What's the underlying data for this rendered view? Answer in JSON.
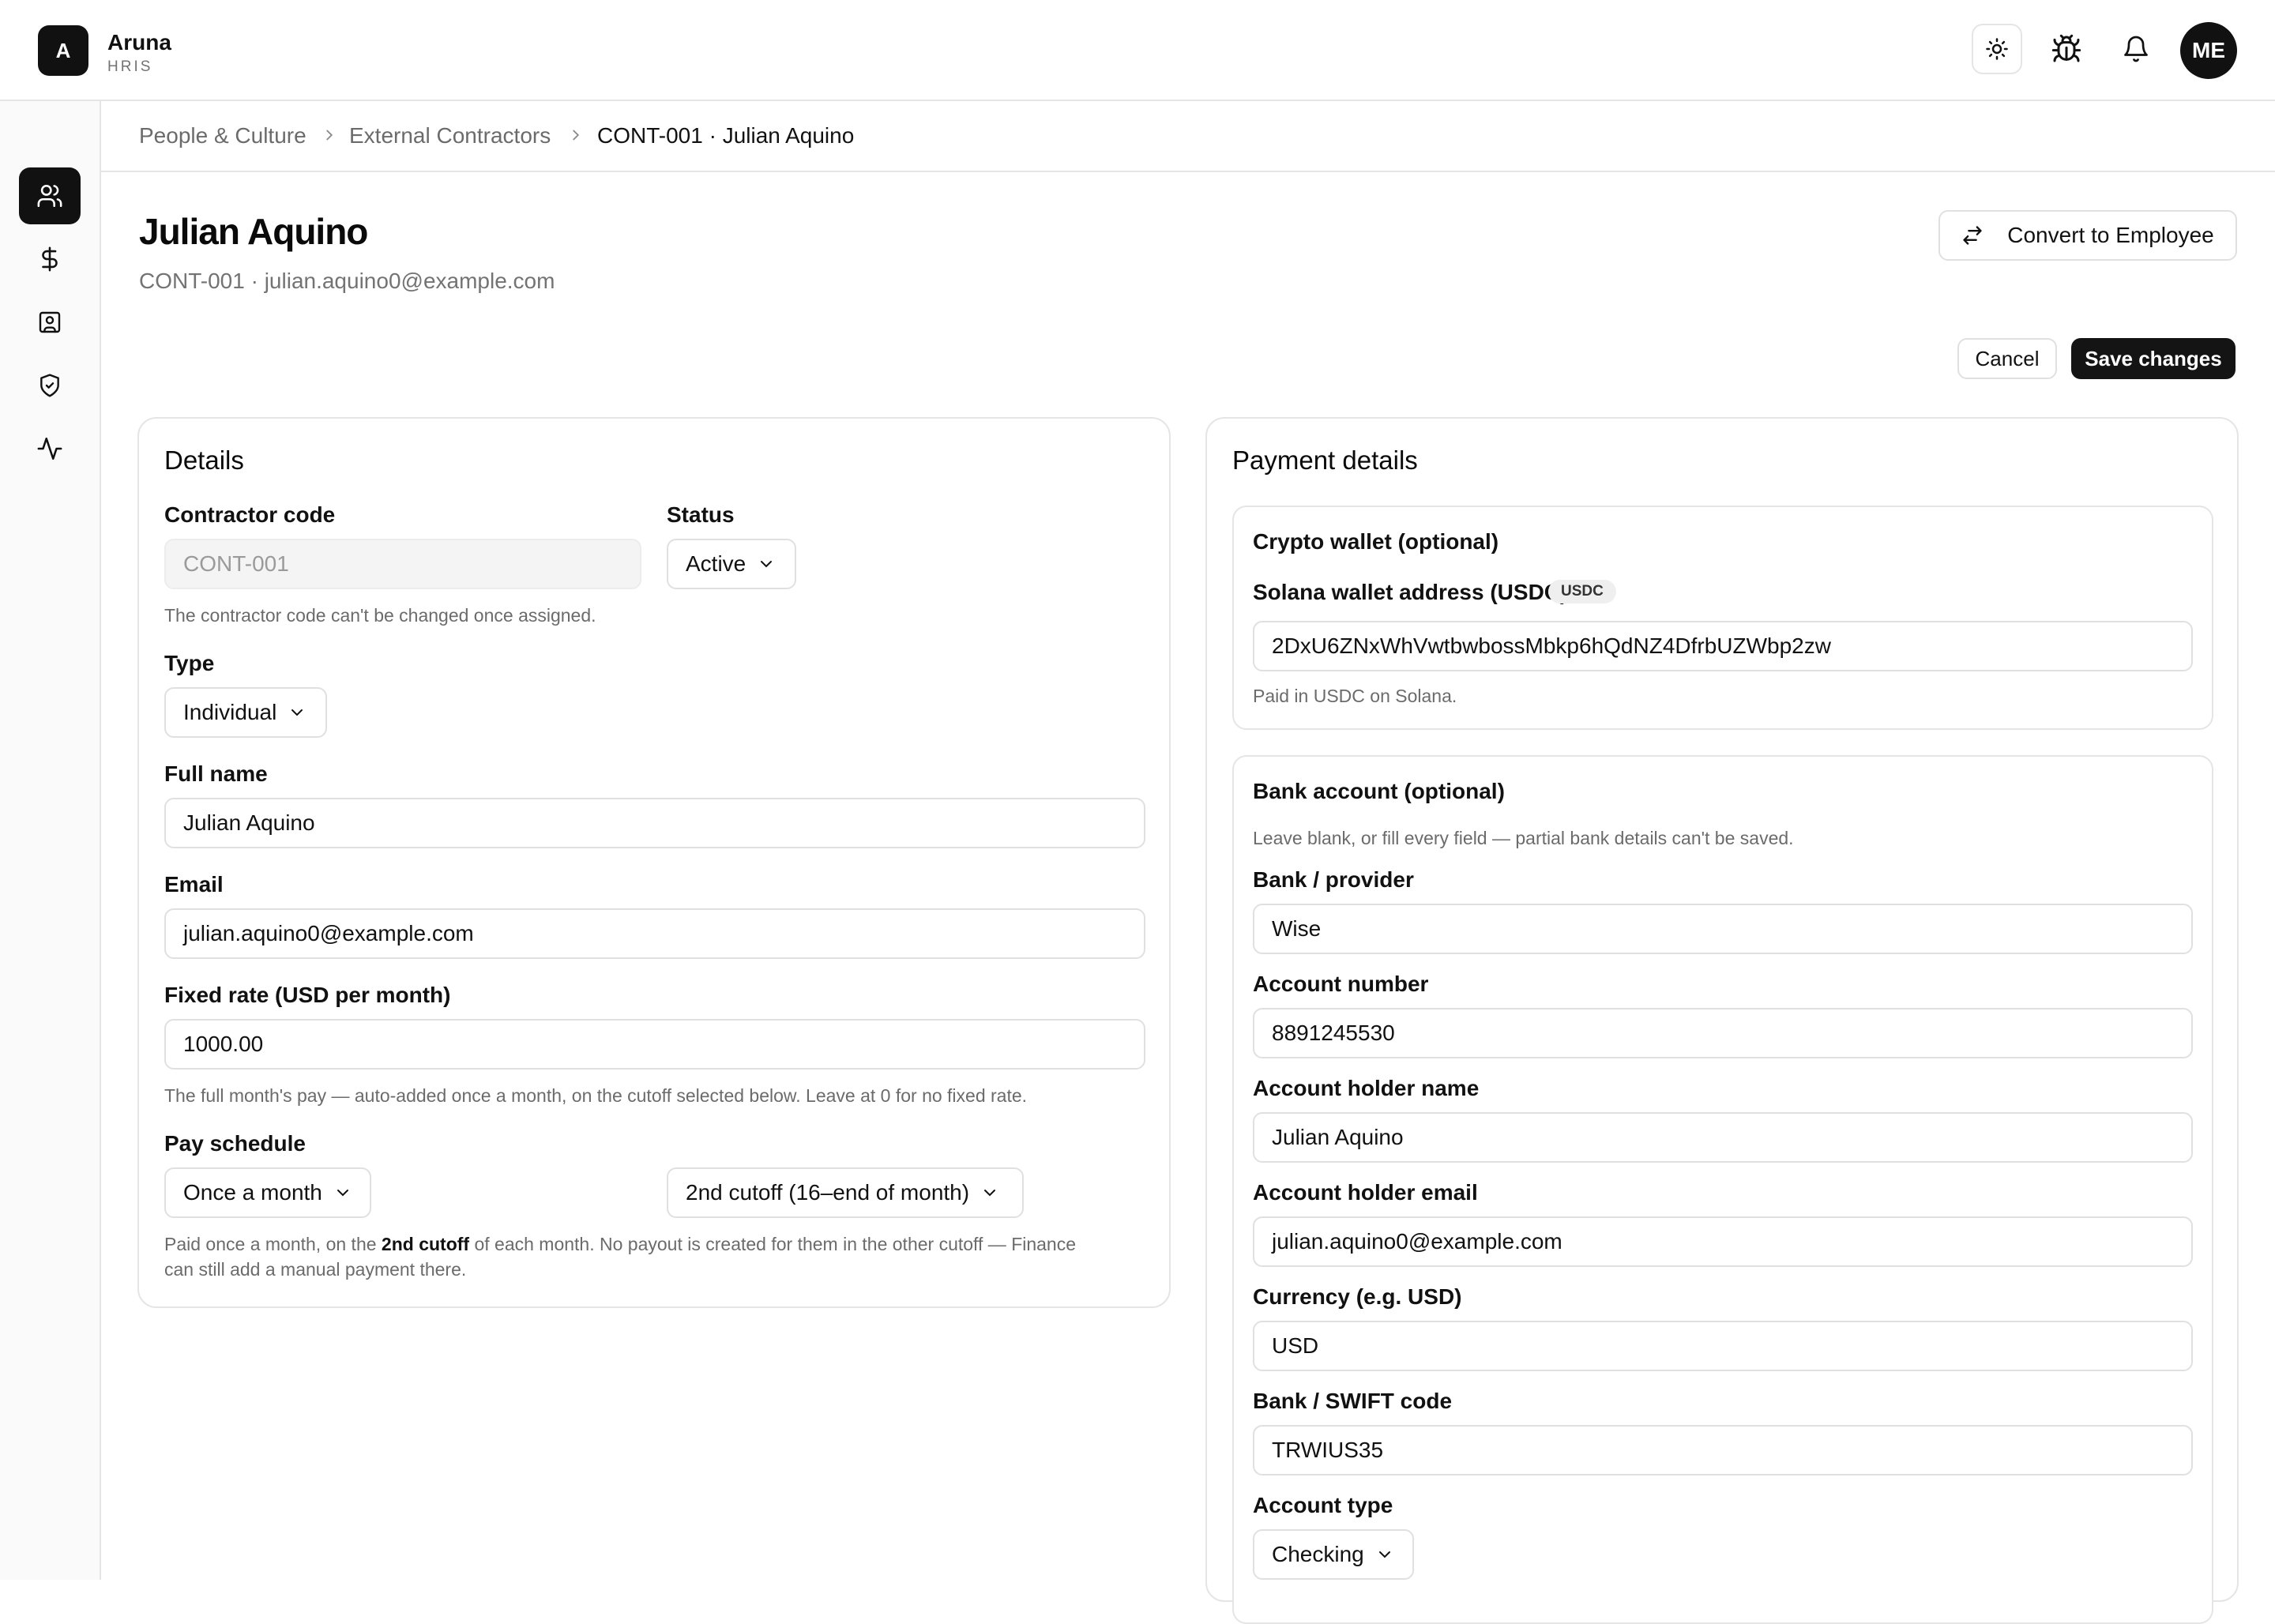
{
  "app": {
    "logo_letter": "A",
    "name": "Aruna",
    "subtitle": "HRIS"
  },
  "topbar": {
    "theme_icon": "sun-icon",
    "bug_icon": "bug-icon",
    "bell_icon": "bell-icon",
    "avatar_initials": "ME"
  },
  "sidebar": {
    "items": [
      {
        "icon": "users-icon",
        "active": true
      },
      {
        "icon": "dollar-icon",
        "active": false
      },
      {
        "icon": "contact-card-icon",
        "active": false
      },
      {
        "icon": "shield-check-icon",
        "active": false
      },
      {
        "icon": "activity-icon",
        "active": false
      }
    ]
  },
  "breadcrumb": {
    "items": [
      "People & Culture",
      "External Contractors",
      "CONT-001 · Julian Aquino"
    ]
  },
  "header": {
    "title": "Julian Aquino",
    "subtitle": "CONT-001 · julian.aquino0@example.com",
    "convert_label": "Convert to Employee",
    "cancel_label": "Cancel",
    "save_label": "Save changes"
  },
  "details": {
    "title": "Details",
    "contractor_code_label": "Contractor code",
    "contractor_code_value": "CONT-001",
    "contractor_code_help": "The contractor code can't be changed once assigned.",
    "status_label": "Status",
    "status_value": "Active",
    "type_label": "Type",
    "type_value": "Individual",
    "full_name_label": "Full name",
    "full_name_value": "Julian Aquino",
    "email_label": "Email",
    "email_value": "julian.aquino0@example.com",
    "rate_label": "Fixed rate (USD per month)",
    "rate_value": "1000.00",
    "rate_help": "The full month's pay — auto-added once a month, on the cutoff selected below. Leave at 0 for no fixed rate.",
    "schedule_label": "Pay schedule",
    "schedule_value": "Once a month",
    "cutoff_value": "2nd cutoff (16–end of month)",
    "schedule_help_pre": "Paid once a month, on the ",
    "schedule_help_bold": "2nd cutoff",
    "schedule_help_post": " of each month. No payout is created for them in the other cutoff — Finance",
    "schedule_help_line2": "can still add a manual payment there."
  },
  "payment": {
    "title": "Payment details",
    "crypto": {
      "title": "Crypto wallet (optional)",
      "wallet_label": "Solana wallet address (USDC)",
      "badge": "USDC",
      "wallet_value": "2DxU6ZNxWhVwtbwbossMbkp6hQdNZ4DfrbUZWbp2zw",
      "help": "Paid in USDC on Solana."
    },
    "bank": {
      "title": "Bank account (optional)",
      "help": "Leave blank, or fill every field — partial bank details can't be saved.",
      "provider_label": "Bank / provider",
      "provider_value": "Wise",
      "account_number_label": "Account number",
      "account_number_value": "8891245530",
      "holder_name_label": "Account holder name",
      "holder_name_value": "Julian Aquino",
      "holder_email_label": "Account holder email",
      "holder_email_value": "julian.aquino0@example.com",
      "currency_label": "Currency (e.g. USD)",
      "currency_value": "USD",
      "swift_label": "Bank / SWIFT code",
      "swift_value": "TRWIUS35",
      "account_type_label": "Account type",
      "account_type_value": "Checking"
    }
  }
}
